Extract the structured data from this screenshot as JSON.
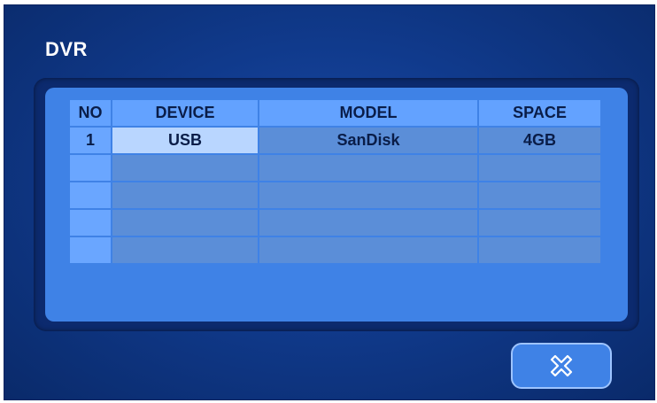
{
  "window": {
    "title": "DVR"
  },
  "table": {
    "headers": [
      "NO",
      "DEVICE",
      "MODEL",
      "SPACE"
    ],
    "rows": [
      {
        "no": "1",
        "device": "USB",
        "model": "SanDisk",
        "space": "4GB"
      },
      {
        "no": "",
        "device": "",
        "model": "",
        "space": ""
      },
      {
        "no": "",
        "device": "",
        "model": "",
        "space": ""
      },
      {
        "no": "",
        "device": "",
        "model": "",
        "space": ""
      },
      {
        "no": "",
        "device": "",
        "model": "",
        "space": ""
      }
    ],
    "selected_row": 0
  },
  "close_button": {
    "icon": "close-icon"
  },
  "colors": {
    "background": "#103a8c",
    "panel": "#3f82e6",
    "header_cell": "#63a2ff",
    "body_cell": "#5b8ed8",
    "selected_cell": "#b9d6ff",
    "text": "#0a1d48",
    "title_text": "#ffffff"
  }
}
